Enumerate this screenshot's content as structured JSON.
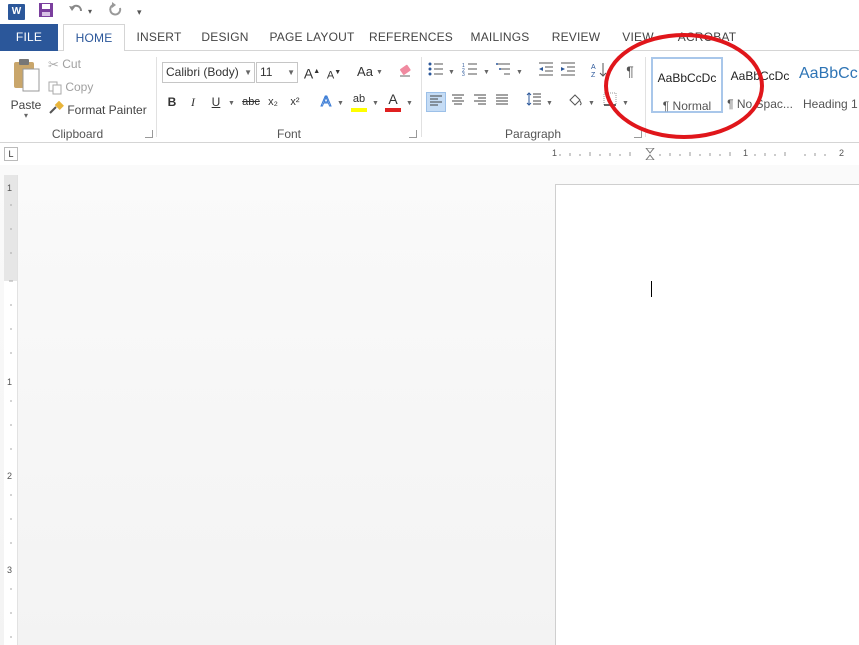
{
  "app": {
    "logo_letter": "W"
  },
  "quick_access": {
    "save": "save-icon",
    "undo": "undo-icon",
    "redo": "redo-icon",
    "customize": "customize-icon"
  },
  "tabs": [
    {
      "label": "FILE"
    },
    {
      "label": "HOME"
    },
    {
      "label": "INSERT"
    },
    {
      "label": "DESIGN"
    },
    {
      "label": "PAGE LAYOUT"
    },
    {
      "label": "REFERENCES"
    },
    {
      "label": "MAILINGS"
    },
    {
      "label": "REVIEW"
    },
    {
      "label": "VIEW"
    },
    {
      "label": "ACROBAT"
    }
  ],
  "clipboard": {
    "paste": "Paste",
    "cut": "Cut",
    "copy": "Copy",
    "format_painter": "Format Painter",
    "group_label": "Clipboard"
  },
  "font": {
    "font_name": "Calibri (Body)",
    "font_size": "11",
    "bold": "B",
    "italic": "I",
    "underline": "U",
    "strikethrough": "abc",
    "subscript": "x₂",
    "superscript": "x²",
    "change_case": "Aa",
    "grow": "A",
    "shrink": "A",
    "text_effects": "A",
    "highlight": "ab",
    "font_color": "A",
    "group_label": "Font"
  },
  "paragraph": {
    "group_label": "Paragraph",
    "pilcrow": "¶"
  },
  "styles": [
    {
      "preview": "AaBbCcDc",
      "name": "¶ Normal"
    },
    {
      "preview": "AaBbCcDc",
      "name": "¶ No Spac..."
    },
    {
      "preview": "AaBbCc",
      "name": "Heading 1"
    }
  ],
  "ruler": {
    "corner": "L",
    "h_labels": [
      "1",
      "1",
      "2"
    ],
    "v_labels": [
      "1",
      "1",
      "2",
      "3"
    ]
  },
  "colors": {
    "accent": "#2b579a",
    "highlight_circle": "#e0161b",
    "font_color_bar": "#e02020",
    "highlight_bar": "#ffff00"
  }
}
